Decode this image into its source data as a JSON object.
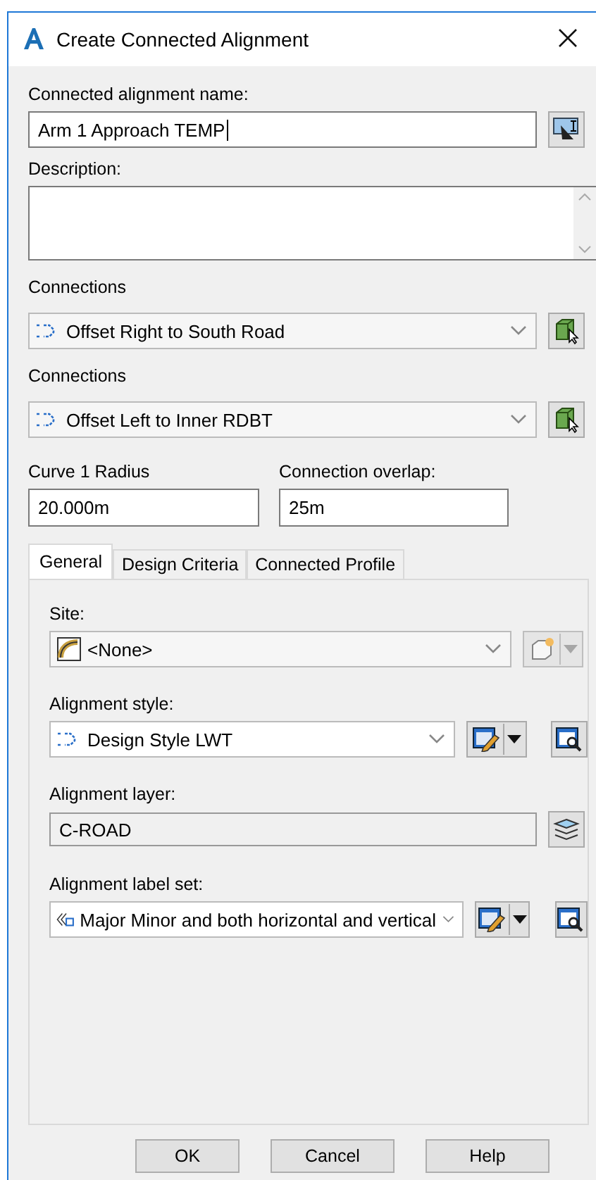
{
  "window": {
    "title": "Create Connected Alignment"
  },
  "name_field": {
    "label": "Connected alignment name:",
    "value": "Arm 1 Approach TEMP"
  },
  "description": {
    "label": "Description:"
  },
  "connections": [
    {
      "label": "Connections",
      "value": "Offset Right to South Road"
    },
    {
      "label": "Connections",
      "value": "Offset Left to Inner RDBT"
    }
  ],
  "curve_radius": {
    "label": "Curve 1 Radius",
    "value": "20.000m"
  },
  "connection_overlap": {
    "label": "Connection overlap:",
    "value": "25m"
  },
  "tabs": [
    {
      "label": "General",
      "selected": true
    },
    {
      "label": "Design Criteria",
      "selected": false
    },
    {
      "label": "Connected Profile",
      "selected": false
    }
  ],
  "general": [
    {
      "kind": "site",
      "label": "Site:",
      "value": "<None>"
    },
    {
      "kind": "style",
      "label": "Alignment style:",
      "value": "Design Style LWT"
    },
    {
      "kind": "layer",
      "label": "Alignment layer:",
      "value": "C-ROAD"
    },
    {
      "kind": "labelset",
      "label": "Alignment label set:",
      "value": "Major Minor and both horizontal and vertical"
    }
  ],
  "buttons": [
    "OK",
    "Cancel",
    "Help"
  ]
}
